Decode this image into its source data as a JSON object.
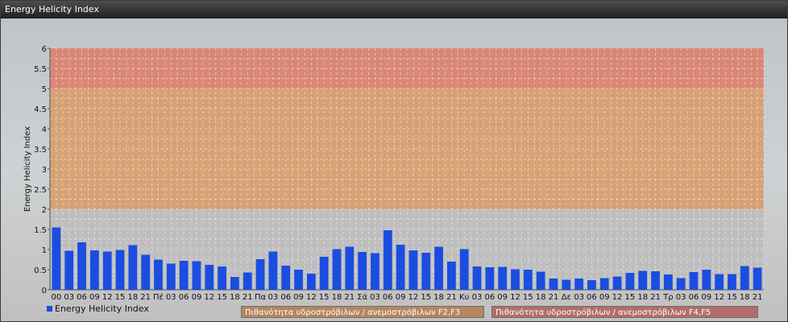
{
  "window": {
    "title": "Energy Helicity Index"
  },
  "colors": {
    "bar": "#1a4de0",
    "band_low": "#bdbdbd",
    "band_mid": "#d89c6a",
    "band_high": "#dc7f6d"
  },
  "legend": {
    "series_label": "Energy Helicity Index",
    "band_mid_label": "Πιθανότητα υδροστρόβιλων / ανεμοστρόβιλων F2,F3",
    "band_high_label": "Πιθανότητα υδροστρόβιλων / ανεμοστρόβιλων F4,F5"
  },
  "chart_data": {
    "type": "bar",
    "ylabel": "Energy Helicity Index",
    "xlabel": "",
    "ylim": [
      0,
      6
    ],
    "yticks": [
      "0",
      "0.5",
      "1",
      "1.5",
      "2",
      "2.5",
      "3",
      "3.5",
      "4",
      "4.5",
      "5",
      "5.5",
      "6"
    ],
    "grid": true,
    "bands": [
      {
        "from": 0,
        "to": 2,
        "color": "#bdbdbd"
      },
      {
        "from": 2,
        "to": 5,
        "color": "#d89c6a",
        "label": "Πιθανότητα υδροστρόβιλων / ανεμοστρόβιλων F2,F3"
      },
      {
        "from": 5,
        "to": 6,
        "color": "#dc7f6d",
        "label": "Πιθανότητα υδροστρόβιλων / ανεμοστρόβιλων F4,F5"
      }
    ],
    "categories": [
      "00",
      "03",
      "06",
      "09",
      "12",
      "15",
      "18",
      "21",
      "Πέ",
      "03",
      "06",
      "09",
      "12",
      "15",
      "18",
      "21",
      "Πα",
      "03",
      "06",
      "09",
      "12",
      "15",
      "18",
      "21",
      "Σά",
      "03",
      "06",
      "09",
      "12",
      "15",
      "18",
      "21",
      "Κυ",
      "03",
      "06",
      "09",
      "12",
      "15",
      "18",
      "21",
      "Δε",
      "03",
      "06",
      "09",
      "12",
      "15",
      "18",
      "21",
      "Τρ",
      "03",
      "06",
      "09",
      "12",
      "15",
      "18",
      "21"
    ],
    "values": [
      1.55,
      0.97,
      1.18,
      0.98,
      0.95,
      0.99,
      1.11,
      0.87,
      0.75,
      0.65,
      0.72,
      0.71,
      0.62,
      0.58,
      0.32,
      0.43,
      0.76,
      0.95,
      0.6,
      0.5,
      0.4,
      0.82,
      1.01,
      1.07,
      0.94,
      0.91,
      1.48,
      1.12,
      0.98,
      0.92,
      1.07,
      0.7,
      1.01,
      0.58,
      0.56,
      0.57,
      0.51,
      0.5,
      0.45,
      0.28,
      0.25,
      0.28,
      0.24,
      0.29,
      0.33,
      0.42,
      0.47,
      0.46,
      0.38,
      0.29,
      0.44,
      0.5,
      0.39,
      0.39,
      0.59,
      0.55
    ],
    "series": [
      {
        "name": "Energy Helicity Index"
      }
    ]
  }
}
